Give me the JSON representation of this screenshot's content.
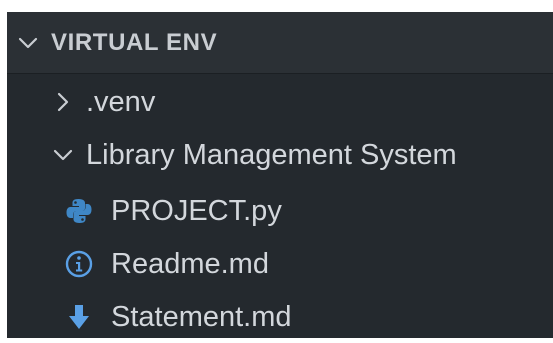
{
  "explorer": {
    "section_title": "VIRTUAL ENV",
    "items": [
      {
        "label": ".venv",
        "type": "folder",
        "expanded": false,
        "icon": "chevron-right-icon"
      },
      {
        "label": "Library Management System",
        "type": "folder",
        "expanded": true,
        "icon": "chevron-down-icon"
      },
      {
        "label": "PROJECT.py",
        "type": "file",
        "icon": "python-icon",
        "icon_color": "#3f87c6"
      },
      {
        "label": "Readme.md",
        "type": "file",
        "icon": "info-icon",
        "icon_color": "#5aa0e6"
      },
      {
        "label": "Statement.md",
        "type": "file",
        "icon": "markdown-download-icon",
        "icon_color": "#5aa0e6"
      }
    ]
  },
  "colors": {
    "background": "#24292e",
    "header_background": "#2b3035",
    "text": "#d3d7dc",
    "accent_blue": "#5aa0e6"
  }
}
